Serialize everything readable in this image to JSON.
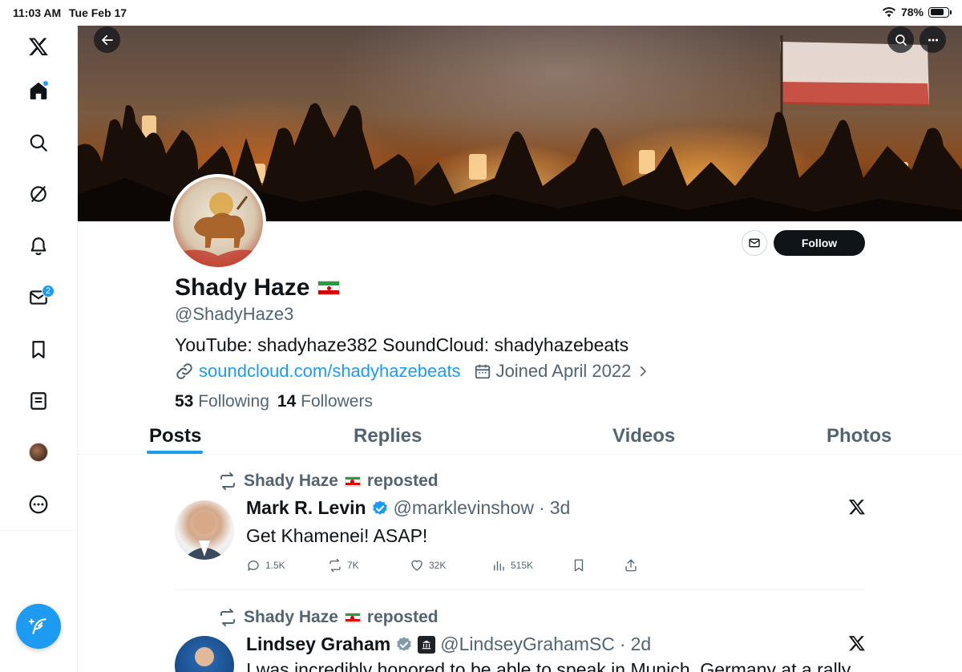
{
  "status_bar": {
    "time": "11:03 AM",
    "date": "Tue Feb 17",
    "battery": "78%",
    "battery_level": 0.78
  },
  "sidebar": {
    "items": [
      "x-logo",
      "home",
      "search",
      "grok",
      "notifications",
      "messages",
      "bookmarks",
      "lists",
      "profile",
      "more"
    ],
    "messages_badge": "2"
  },
  "profile": {
    "name": "Shady Haze",
    "handle": "@ShadyHaze3",
    "bio": "YouTube: shadyhaze382 SoundCloud: shadyhazebeats",
    "link": "soundcloud.com/shadyhazebeats",
    "joined": "Joined April 2022",
    "following_count": "53",
    "following_label": "Following",
    "followers_count": "14",
    "followers_label": "Followers",
    "follow_label": "Follow"
  },
  "tabs": [
    {
      "label": "Posts",
      "active": true
    },
    {
      "label": "Replies",
      "active": false
    },
    {
      "label": "Videos",
      "active": false
    },
    {
      "label": "Photos",
      "active": false
    }
  ],
  "posts": [
    {
      "repost_by": "Shady Haze",
      "repost_label": "reposted",
      "name": "Mark R. Levin",
      "handle": "@marklevinshow",
      "time": "3d",
      "text": "Get Khamenei!  ASAP!",
      "replies": "1.5K",
      "reposts": "7K",
      "likes": "32K",
      "views": "515K"
    },
    {
      "repost_by": "Shady Haze",
      "repost_label": "reposted",
      "name": "Lindsey Graham",
      "handle": "@LindseyGrahamSC",
      "time": "2d",
      "text": "I was incredibly honored to be able to speak in Munich, Germany at a rally"
    }
  ],
  "colors": {
    "accent": "#1d9bf0",
    "text": "#0f1419",
    "muted": "#536471",
    "border": "#eff3f4"
  }
}
